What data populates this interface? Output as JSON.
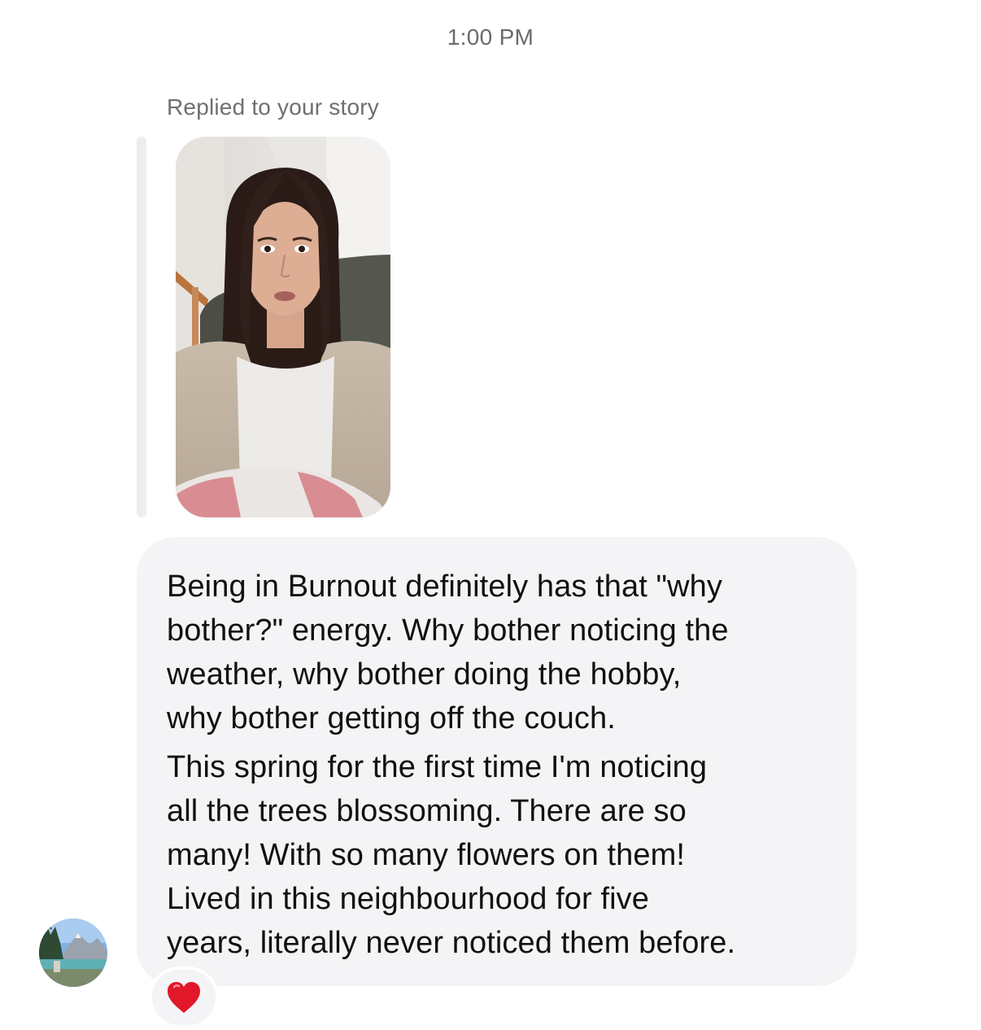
{
  "conversation": {
    "timestamp": "1:00 PM",
    "reply_context": {
      "label": "Replied to your story"
    },
    "message": {
      "paragraphs": [
        "Being in Burnout definitely has that \"why\nbother?\" energy. Why bother noticing the\nweather, why bother doing the hobby,\nwhy bother getting off the couch.",
        "This spring for the first time I'm noticing\nall the trees blossoming. There are so\nmany! With so many flowers on them!\nLived in this neighbourhood for five\nyears, literally never noticed them before."
      ],
      "reaction": "heart-emoji"
    },
    "sender": {
      "avatar_icon": "profile-photo"
    }
  },
  "colors": {
    "bubble_background": "#f4f4f6",
    "reply_bar": "#ededef",
    "timestamp_text": "#6b6b6b",
    "reaction_heart": "#e0182a"
  }
}
